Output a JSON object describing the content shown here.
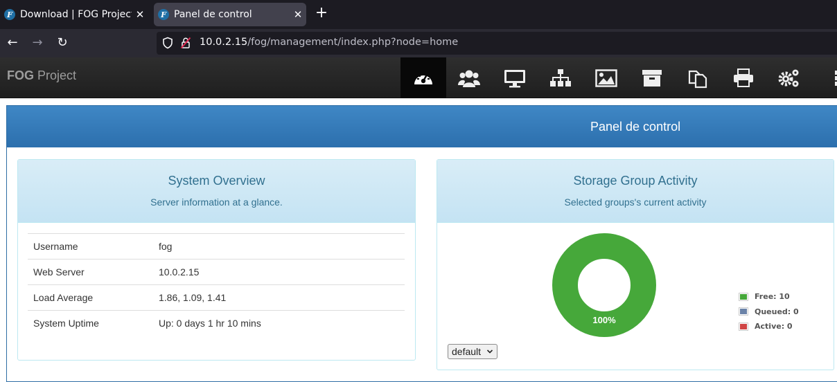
{
  "browser": {
    "tabs": [
      {
        "favicon": "F",
        "title": "Download | FOG Project",
        "active": false
      },
      {
        "favicon": "F",
        "title": "Panel de control",
        "active": true
      }
    ],
    "new_tab_label": "+",
    "url_host": "10.0.2.15",
    "url_path": "/fog/management/index.php?node=home",
    "nav": {
      "back": "←",
      "forward": "→",
      "reload": "↻"
    }
  },
  "header": {
    "brand_bold": "FOG",
    "brand_rest": " Project",
    "menu": [
      {
        "icon": "dashboard-icon",
        "active": true
      },
      {
        "icon": "users-icon",
        "active": false
      },
      {
        "icon": "monitor-icon",
        "active": false
      },
      {
        "icon": "sitemap-icon",
        "active": false
      },
      {
        "icon": "image-icon",
        "active": false
      },
      {
        "icon": "archive-icon",
        "active": false
      },
      {
        "icon": "copy-icon",
        "active": false
      },
      {
        "icon": "printer-icon",
        "active": false
      },
      {
        "icon": "cogs-icon",
        "active": false
      },
      {
        "icon": "server-icon",
        "active": false
      }
    ]
  },
  "main": {
    "title": "Panel de control",
    "system_overview": {
      "title": "System Overview",
      "subtitle": "Server information at a glance.",
      "rows": [
        {
          "label": "Username",
          "value": "fog"
        },
        {
          "label": "Web Server",
          "value": "10.0.2.15"
        },
        {
          "label": "Load Average",
          "value": "1.86, 1.09, 1.41"
        },
        {
          "label": "System Uptime",
          "value": "Up: 0 days 1 hr 10 mins"
        }
      ]
    },
    "storage_activity": {
      "title": "Storage Group Activity",
      "subtitle": "Selected groups's current activity",
      "donut_percent_label": "100%",
      "legend": [
        {
          "label": "Free: 10",
          "value": 10,
          "color": "#46a83a"
        },
        {
          "label": "Queued: 0",
          "value": 0,
          "color": "#6b83a8"
        },
        {
          "label": "Active: 0",
          "value": 0,
          "color": "#d04545"
        }
      ],
      "group_select": "default"
    }
  }
}
